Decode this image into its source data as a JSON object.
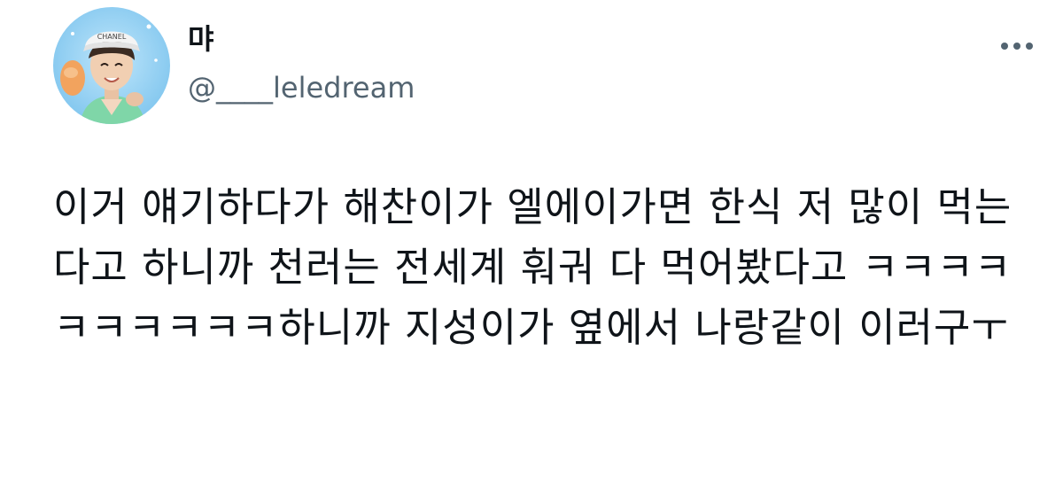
{
  "tweet": {
    "author": {
      "display_name": "먀",
      "handle": "@____leledream",
      "avatar": "profile-photo-avatar"
    },
    "more_icon": "more-options-icon",
    "text": "이거 얘기하다가 해찬이가 엘에이가면 한식 저 많이 먹는다고 하니까 천러는 전세계 훠궈 다 먹어봤다고 ㅋㅋㅋㅋㅋㅋㅋㅋㅋㅋ하니까 지성이가 옆에서 나랑같이 이러구ㅜ"
  },
  "colors": {
    "text": "#0f1419",
    "secondary": "#536471",
    "avatar_background": "#8ecdf2"
  }
}
